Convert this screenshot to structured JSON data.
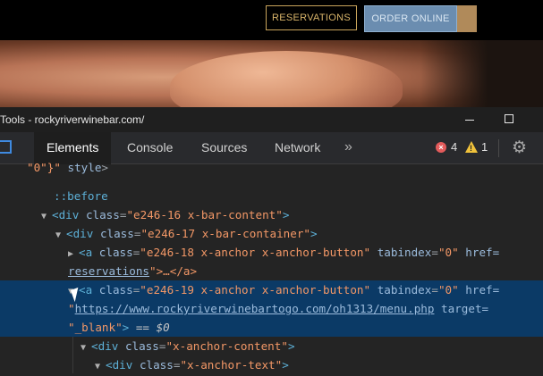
{
  "site": {
    "reservations_label": "RESERVATIONS",
    "order_online_label": "ORDER ONLINE",
    "colors": {
      "header_bg": "#000000",
      "gold": "#c9a45b",
      "order_bg": "#6b8db0"
    }
  },
  "window": {
    "title": "Tools - rockyriverwinebar.com/"
  },
  "devtools": {
    "tabs": [
      {
        "label": "Elements",
        "active": true
      },
      {
        "label": "Console",
        "active": false
      },
      {
        "label": "Sources",
        "active": false
      },
      {
        "label": "Network",
        "active": false
      }
    ],
    "more_tabs_symbol": "»",
    "errors_count": "4",
    "warnings_count": "1",
    "icons": [
      "inspect-icon",
      "error-icon",
      "warning-icon",
      "gear-icon"
    ]
  },
  "dom": {
    "l0_val": "\"0\"}\"",
    "l0_attr": " style",
    "l0_close": ">",
    "before": "::before",
    "l2_tag": "div",
    "l2_attr": "class",
    "l2_val": "\"e246-16 x-bar-content\"",
    "l3_tag": "div",
    "l3_attr": "class",
    "l3_val": "\"e246-17 x-bar-container\"",
    "l4_tag": "a",
    "l4_attr1": "class",
    "l4_val1": "\"e246-18 x-anchor x-anchor-button\"",
    "l4_attr2": "tabindex",
    "l4_val2": "\"0\"",
    "l4_attr3": "href=",
    "l5_link": "reservations",
    "l5_rest": "\">…</a>",
    "l6_tag": "a",
    "l6_attr1": "class",
    "l6_val1": "\"e246-19 x-anchor x-anchor-button\"",
    "l6_attr2": "tabindex",
    "l6_val2": "\"0\"",
    "l6_attr3": "href=",
    "l7_link": "https://www.rockyriverwinebartogo.com/oh1313/menu.php",
    "l7_attr": " target=",
    "l8_val": "\"_blank\"",
    "l8_eq": " == $0",
    "l9_tag": "div",
    "l9_attr": "class",
    "l9_val": "\"x-anchor-content\"",
    "l10_tag": "div",
    "l10_attr": "class",
    "l10_val": "\"x-anchor-text\""
  }
}
